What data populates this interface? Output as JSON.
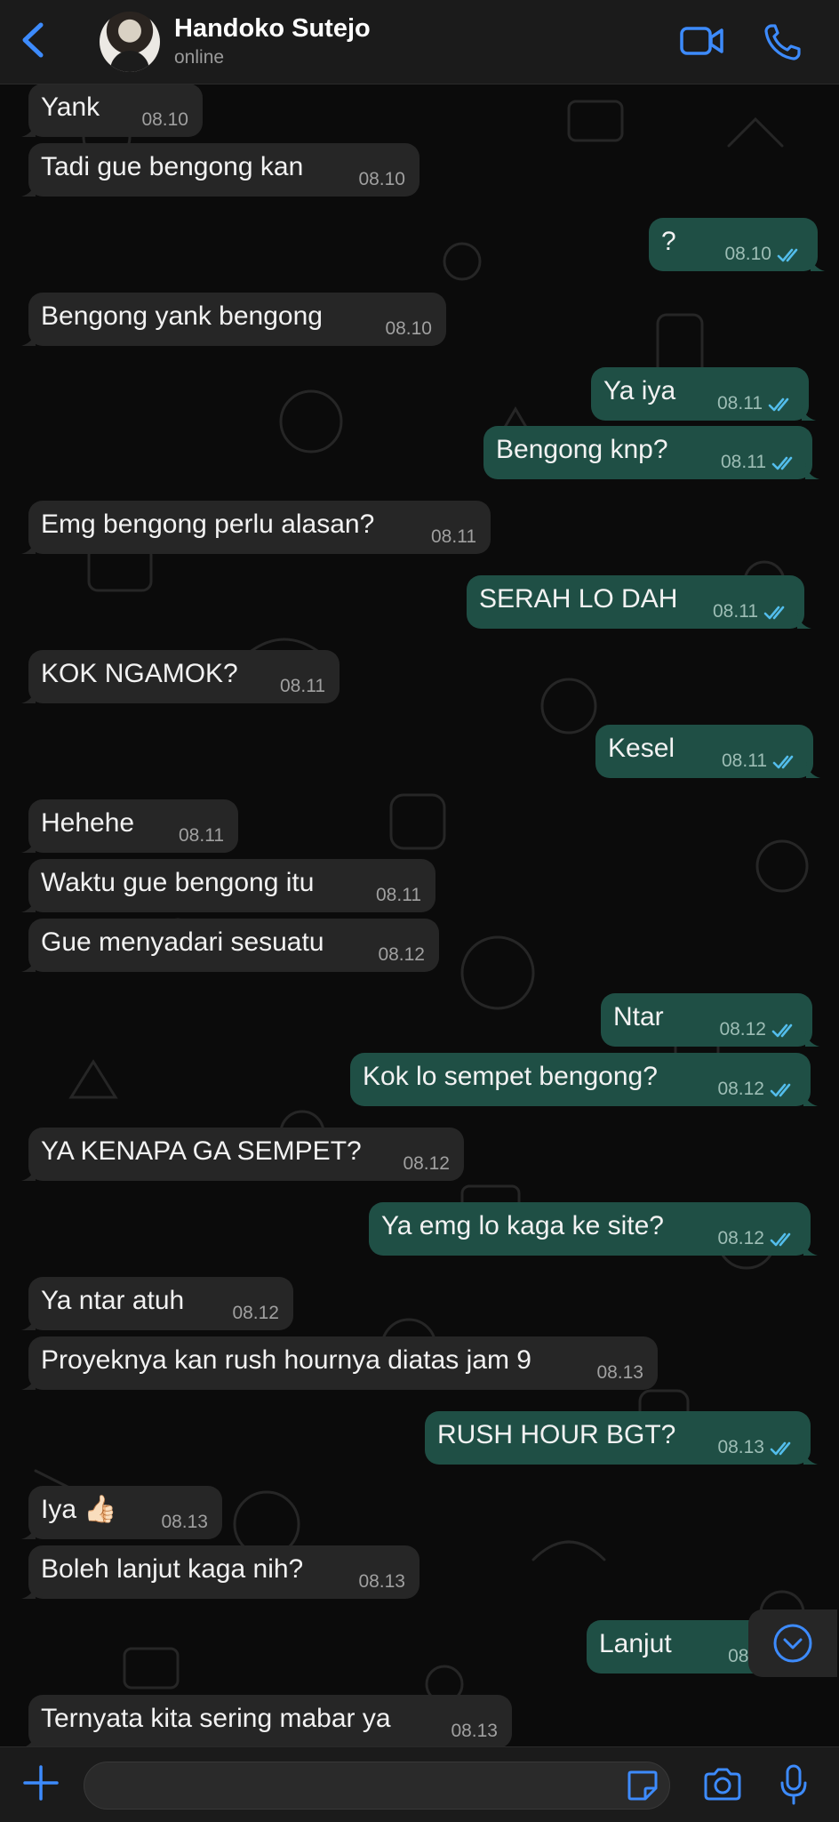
{
  "header": {
    "back_icon": "chevron-left-icon",
    "contact_name": "Handoko Sutejo",
    "contact_status": "online",
    "video_icon": "video-camera-icon",
    "call_icon": "phone-icon"
  },
  "messages": [
    {
      "dir": "in",
      "text": "Yank",
      "time": "08.10"
    },
    {
      "dir": "in",
      "text": "Tadi gue bengong kan",
      "time": "08.10"
    },
    {
      "dir": "out",
      "text": "?",
      "time": "08.10",
      "read": true
    },
    {
      "dir": "in",
      "text": "Bengong yank bengong",
      "time": "08.10"
    },
    {
      "dir": "out",
      "text": "Ya iya",
      "time": "08.11",
      "read": true
    },
    {
      "dir": "out",
      "text": "Bengong knp?",
      "time": "08.11",
      "read": true
    },
    {
      "dir": "in",
      "text": "Emg bengong perlu alasan?",
      "time": "08.11"
    },
    {
      "dir": "out",
      "text": "SERAH LO DAH",
      "time": "08.11",
      "read": true
    },
    {
      "dir": "in",
      "text": "KOK NGAMOK?",
      "time": "08.11"
    },
    {
      "dir": "out",
      "text": "Kesel",
      "time": "08.11",
      "read": true
    },
    {
      "dir": "in",
      "text": "Hehehe",
      "time": "08.11"
    },
    {
      "dir": "in",
      "text": "Waktu gue bengong itu",
      "time": "08.11"
    },
    {
      "dir": "in",
      "text": "Gue menyadari sesuatu",
      "time": "08.12"
    },
    {
      "dir": "out",
      "text": "Ntar",
      "time": "08.12",
      "read": true
    },
    {
      "dir": "out",
      "text": "Kok lo sempet bengong?",
      "time": "08.12",
      "read": true
    },
    {
      "dir": "in",
      "text": "YA KENAPA GA SEMPET?",
      "time": "08.12"
    },
    {
      "dir": "out",
      "text": "Ya emg lo kaga ke site?",
      "time": "08.12",
      "read": true
    },
    {
      "dir": "in",
      "text": "Ya ntar atuh",
      "time": "08.12"
    },
    {
      "dir": "in",
      "text": "Proyeknya kan rush hournya diatas jam 9",
      "time": "08.13"
    },
    {
      "dir": "out",
      "text": "RUSH HOUR BGT?",
      "time": "08.13",
      "read": true
    },
    {
      "dir": "in",
      "text": "Iya 👍🏻",
      "time": "08.13"
    },
    {
      "dir": "in",
      "text": "Boleh lanjut kaga nih?",
      "time": "08.13"
    },
    {
      "dir": "out",
      "text": "Lanjut",
      "time": "08.1",
      "read": true
    },
    {
      "dir": "in",
      "text": "Ternyata kita sering mabar ya",
      "time": "08.13"
    }
  ],
  "scroll_down_icon": "chevron-down-circle-icon",
  "input_bar": {
    "plus_icon": "plus-icon",
    "placeholder": "",
    "sticker_icon": "sticker-icon",
    "camera_icon": "camera-icon",
    "mic_icon": "microphone-icon"
  },
  "colors": {
    "accent": "#3d8bfd",
    "incoming_bubble": "#262626",
    "outgoing_bubble": "#1f4f45",
    "read_ticks": "#53bdeb"
  }
}
